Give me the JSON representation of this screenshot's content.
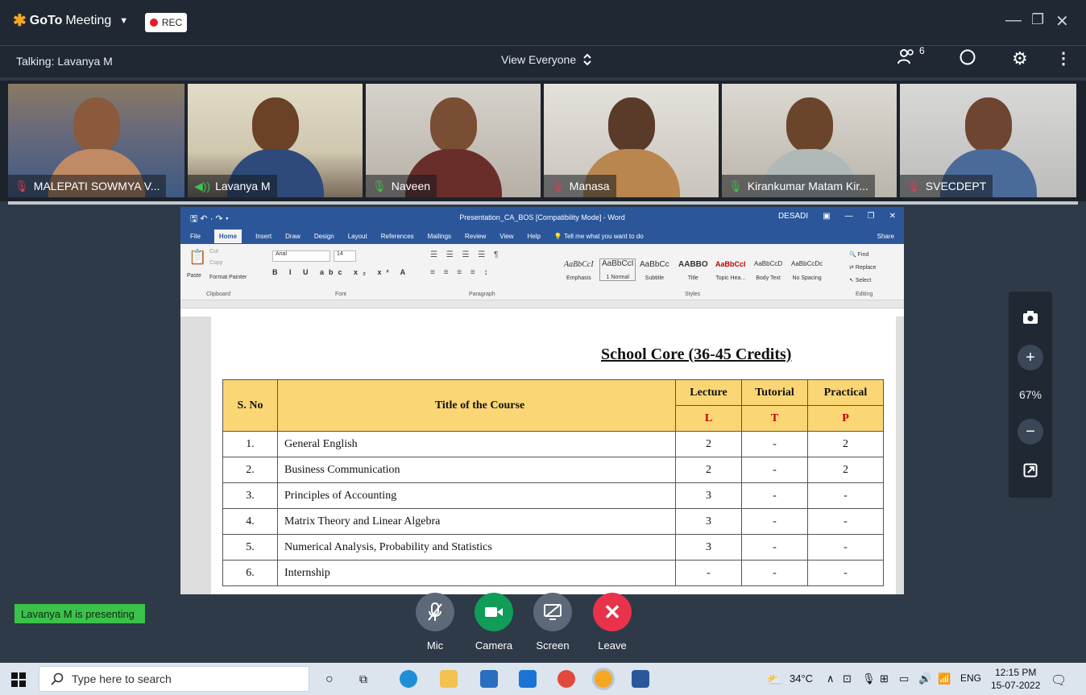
{
  "app": {
    "name_bold": "GoTo",
    "name_rest": "Meeting",
    "rec_label": "REC"
  },
  "topbar": {
    "talking": "Talking: Lavanya M",
    "view": "View Everyone",
    "participants_count": "6"
  },
  "participants": [
    {
      "name": "MALEPATI SOWMYA V...",
      "muted": true
    },
    {
      "name": "Lavanya M",
      "muted": false,
      "speaking": true
    },
    {
      "name": "Naveen",
      "muted": false
    },
    {
      "name": "Manasa",
      "muted": true
    },
    {
      "name": "Kirankumar Matam Kir...",
      "muted": false
    },
    {
      "name": "SVECDEPT",
      "muted": true
    }
  ],
  "word": {
    "title": "Presentation_CA_BOS [Compatibility Mode] - Word",
    "user": "DESADI",
    "tabs": [
      "File",
      "Home",
      "Insert",
      "Draw",
      "Design",
      "Layout",
      "References",
      "Mailings",
      "Review",
      "View",
      "Help"
    ],
    "tell_me": "Tell me what you want to do",
    "share": "Share",
    "clipboard": {
      "paste": "Paste",
      "cut": "Cut",
      "copy": "Copy",
      "format_painter": "Format Painter",
      "label": "Clipboard"
    },
    "font": {
      "name": "Arial",
      "size": "14",
      "label": "Font"
    },
    "paragraph_label": "Paragraph",
    "styles": [
      {
        "preview": "AaBbCcI",
        "name": "Emphasis"
      },
      {
        "preview": "AaBbCcI",
        "name": "1 Normal"
      },
      {
        "preview": "AaBbCc",
        "name": "Subtitle"
      },
      {
        "preview": "AABBO",
        "name": "Title"
      },
      {
        "preview": "AaBbCcI",
        "name": "Topic Hea..."
      },
      {
        "preview": "AaBbCcD",
        "name": "Body Text"
      },
      {
        "preview": "AaBbCcDc",
        "name": "No Spacing"
      }
    ],
    "styles_label": "Styles",
    "editing": {
      "find": "Find",
      "replace": "Replace",
      "select": "Select",
      "label": "Editing"
    }
  },
  "document": {
    "heading": "School Core (36-45 Credits)",
    "headers": {
      "sno": "S. No",
      "title": "Title of the Course",
      "lecture": "Lecture",
      "tutorial": "Tutorial",
      "practical": "Practical",
      "l": "L",
      "t": "T",
      "p": "P"
    },
    "rows": [
      {
        "sno": "1.",
        "title": "General English",
        "l": "2",
        "t": "-",
        "p": "2"
      },
      {
        "sno": "2.",
        "title": "Business Communication",
        "l": "2",
        "t": "-",
        "p": "2"
      },
      {
        "sno": "3.",
        "title": "Principles of Accounting",
        "l": "3",
        "t": "-",
        "p": "-"
      },
      {
        "sno": "4.",
        "title": "Matrix Theory and Linear Algebra",
        "l": "3",
        "t": "-",
        "p": "-"
      },
      {
        "sno": "5.",
        "title": "Numerical Analysis, Probability and Statistics",
        "l": "3",
        "t": "-",
        "p": "-"
      },
      {
        "sno": "6.",
        "title": "Internship",
        "l": "-",
        "t": "-",
        "p": "-"
      }
    ]
  },
  "zoom": {
    "level": "67%"
  },
  "presenting": "Lavanya M is presenting",
  "controls": {
    "mic": "Mic",
    "camera": "Camera",
    "screen": "Screen",
    "leave": "Leave"
  },
  "taskbar": {
    "search_placeholder": "Type here to search",
    "weather": "34°C",
    "language": "ENG",
    "time": "12:15 PM",
    "date": "15-07-2022"
  },
  "colors": {
    "accent_green": "#3ac24a",
    "rec_red": "#e8192c",
    "leave_red": "#e8334a",
    "camera_green": "#0f9d58",
    "word_blue": "#2b579a",
    "header_yellow": "#fbd674"
  }
}
